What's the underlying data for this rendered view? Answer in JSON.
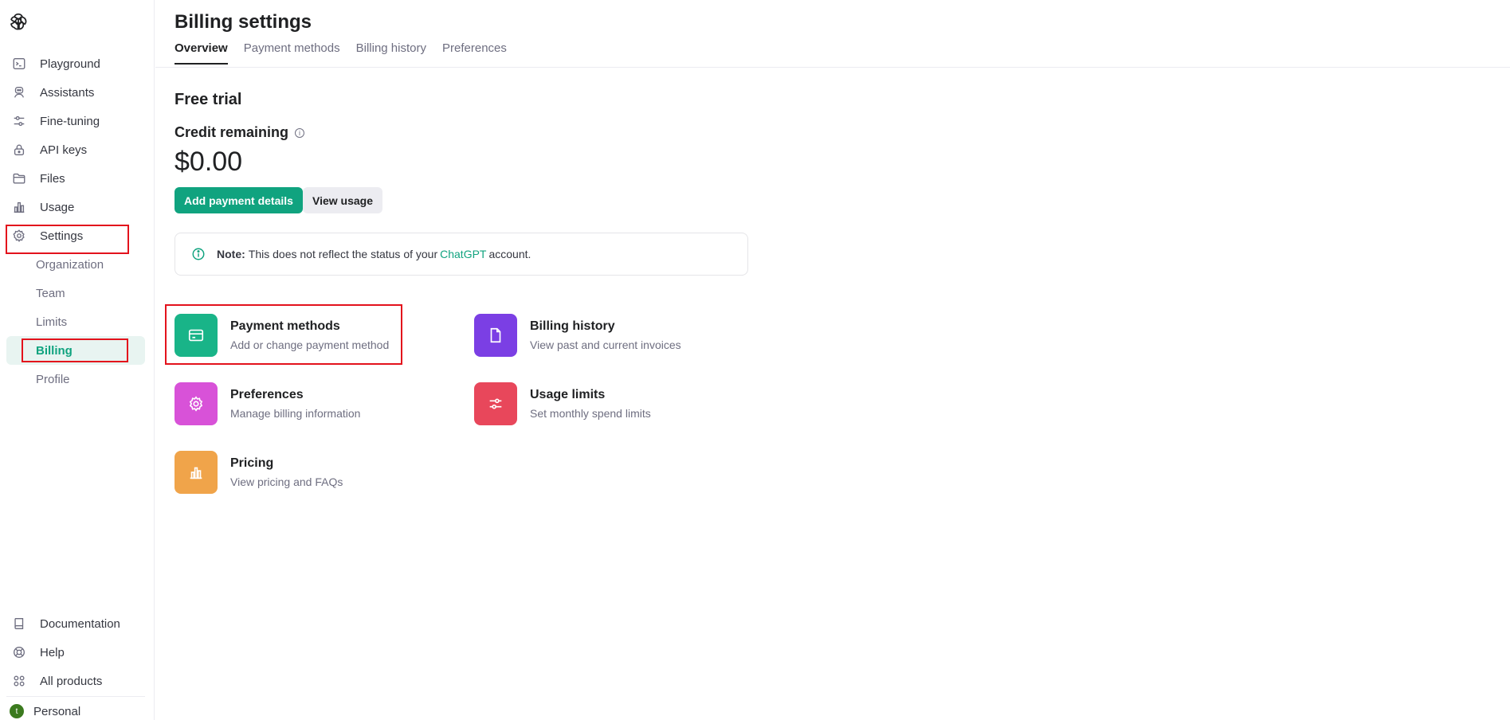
{
  "sidebar": {
    "items": [
      {
        "label": "Playground",
        "icon": "terminal-icon"
      },
      {
        "label": "Assistants",
        "icon": "robot-icon"
      },
      {
        "label": "Fine-tuning",
        "icon": "sliders-icon"
      },
      {
        "label": "API keys",
        "icon": "lock-icon"
      },
      {
        "label": "Files",
        "icon": "folder-icon"
      },
      {
        "label": "Usage",
        "icon": "bar-chart-icon"
      },
      {
        "label": "Settings",
        "icon": "gear-icon"
      }
    ],
    "sub_items": [
      {
        "label": "Organization"
      },
      {
        "label": "Team"
      },
      {
        "label": "Limits"
      },
      {
        "label": "Billing"
      },
      {
        "label": "Profile"
      }
    ],
    "bottom_items": [
      {
        "label": "Documentation",
        "icon": "book-icon"
      },
      {
        "label": "Help",
        "icon": "lifebuoy-icon"
      },
      {
        "label": "All products",
        "icon": "grid-icon"
      }
    ],
    "account": {
      "initial": "t",
      "label": "Personal"
    }
  },
  "header": {
    "title": "Billing settings",
    "tabs": [
      {
        "label": "Overview"
      },
      {
        "label": "Payment methods"
      },
      {
        "label": "Billing history"
      },
      {
        "label": "Preferences"
      }
    ]
  },
  "overview": {
    "section_title": "Free trial",
    "credit_label": "Credit remaining",
    "credit_value": "$0.00",
    "add_payment_label": "Add payment details",
    "view_usage_label": "View usage",
    "note": {
      "prefix": "Note:",
      "text_before": "This does not reflect the status of your",
      "link": "ChatGPT",
      "text_after": "account."
    }
  },
  "cards": [
    {
      "title": "Payment methods",
      "desc": "Add or change payment method",
      "color": "#19b488",
      "icon": "credit-card-icon"
    },
    {
      "title": "Billing history",
      "desc": "View past and current invoices",
      "color": "#7b3fe4",
      "icon": "document-icon"
    },
    {
      "title": "Preferences",
      "desc": "Manage billing information",
      "color": "#d852d8",
      "icon": "gear-icon"
    },
    {
      "title": "Usage limits",
      "desc": "Set monthly spend limits",
      "color": "#e8475b",
      "icon": "sliders-icon"
    },
    {
      "title": "Pricing",
      "desc": "View pricing and FAQs",
      "color": "#f0a44a",
      "icon": "bar-chart-icon"
    }
  ],
  "colors": {
    "accent": "#10a37f",
    "highlight": "#e3121c"
  }
}
